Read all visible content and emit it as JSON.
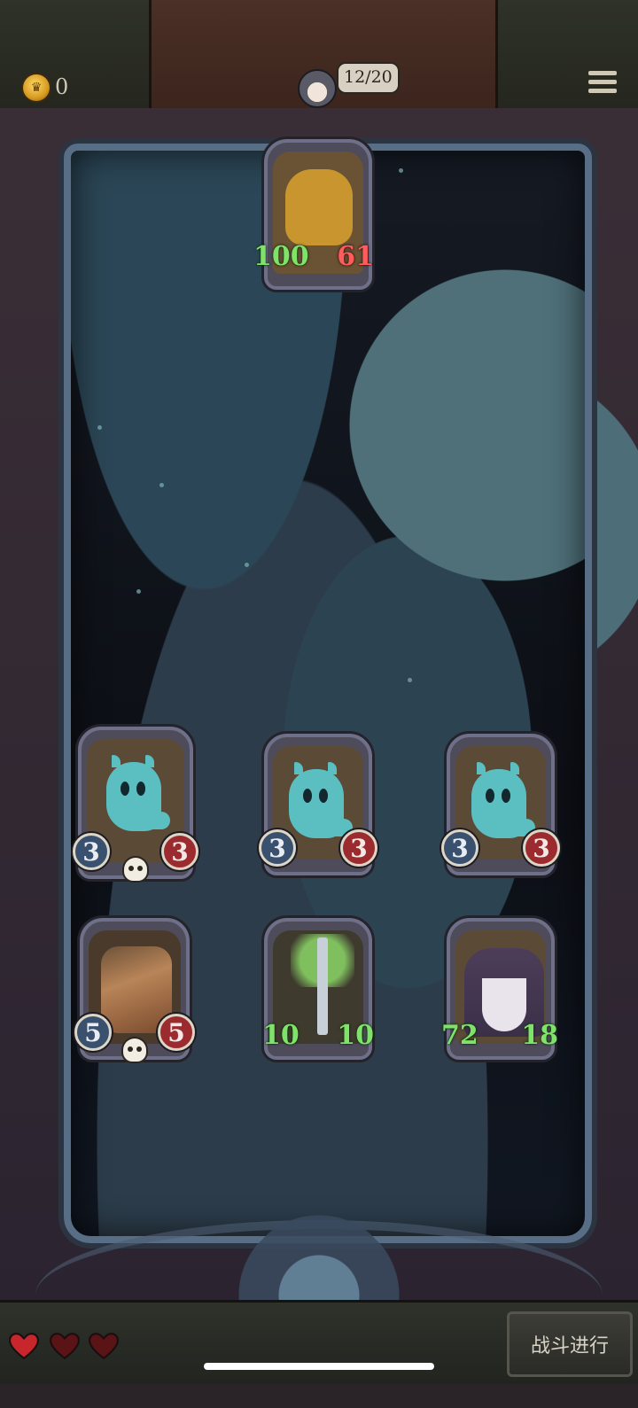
{
  "hud": {
    "gold": "0",
    "round": "12/20",
    "menu_icon": "hamburger-menu-icon"
  },
  "enemy": {
    "name": "brute",
    "attack": "100",
    "health": "61"
  },
  "board": {
    "row1": [
      {
        "kind": "ghost",
        "attack": "3",
        "health": "3",
        "skull": true
      },
      {
        "kind": "ghost",
        "attack": "3",
        "health": "3",
        "skull": false
      },
      {
        "kind": "ghost",
        "attack": "3",
        "health": "3",
        "skull": false
      }
    ],
    "row2": [
      {
        "kind": "warrior",
        "attack": "5",
        "health": "5",
        "skull": true
      },
      {
        "kind": "cursed-sword",
        "attack": "10",
        "health": "10",
        "skull": false
      },
      {
        "kind": "cat-pharaoh",
        "attack": "72",
        "health": "18",
        "skull": false
      }
    ]
  },
  "footer": {
    "lives": 3,
    "battle_label": "战斗进行"
  },
  "colors": {
    "attack_badge": "#39506e",
    "health_badge": "#9c2b2f",
    "buffed_stat": "#7fe36a"
  }
}
